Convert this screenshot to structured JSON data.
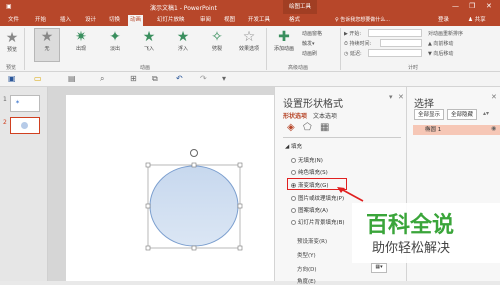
{
  "titlebar": {
    "doc_title": "演示文稿1 - PowerPoint",
    "context_tab": "绘图工具",
    "minimize": "—",
    "restore": "❐",
    "close": "✕"
  },
  "tabs": [
    "文件",
    "开始",
    "插入",
    "设计",
    "切换",
    "动画",
    "幻灯片放映",
    "审阅",
    "视图",
    "开发工具",
    "格式"
  ],
  "active_tab": "动画",
  "tellme": "♀ 告诉我您想要做什么...",
  "signin": "登录",
  "share": "♟ 共享",
  "ribbon": {
    "preview_label": "预览",
    "effects": [
      {
        "label": "无",
        "selected": true
      },
      {
        "label": "出现"
      },
      {
        "label": "淡出"
      },
      {
        "label": "飞入"
      },
      {
        "label": "浮入"
      },
      {
        "label": "劈裂"
      }
    ],
    "effect_options": "效果选项",
    "add_animation": "添加动画",
    "animation_pane": "动画窗格",
    "trigger": "触发▾",
    "animation_painter": "动画刷",
    "start": "▶ 开始:",
    "duration": "⏱ 持续时间:",
    "delay": "◷ 延迟:",
    "reorder": "对动画重新排序",
    "move_earlier": "▲ 向前移动",
    "move_later": "▼ 向后移动",
    "groups": {
      "preview": "预览",
      "animation": "动画",
      "advanced": "高级动画",
      "timing": "计时"
    }
  },
  "qat": {
    "save_icon": "💾",
    "open_icon": "📂",
    "undo": "↶",
    "redo": "↷"
  },
  "thumbs": [
    "1",
    "2"
  ],
  "format_pane": {
    "title": "设置形状格式",
    "tab_shape": "形状选项",
    "tab_text": "文本选项",
    "section_fill": "◢ 填充",
    "options": [
      {
        "label": "无填充(N)",
        "on": false
      },
      {
        "label": "纯色填充(S)",
        "on": false
      },
      {
        "label": "渐变填充(G)",
        "on": true
      },
      {
        "label": "图片或纹理填充(P)",
        "on": false
      },
      {
        "label": "图案填充(A)",
        "on": false
      },
      {
        "label": "幻灯片背景填充(B)",
        "on": false
      }
    ],
    "preset_gradient": "预设渐变(R)",
    "type": "类型(Y)",
    "direction": "方向(D)",
    "angle": "角度(E)"
  },
  "selection_pane": {
    "title": "选择",
    "show_all": "全部显示",
    "hide_all": "全部隐藏",
    "item": "椭圆 1"
  },
  "watermark": {
    "main": "百科全说",
    "sub": "助你轻松解决"
  },
  "colors": {
    "accent": "#b7472a",
    "highlight": "#e02020",
    "selection_item": "#f6c7b6"
  }
}
